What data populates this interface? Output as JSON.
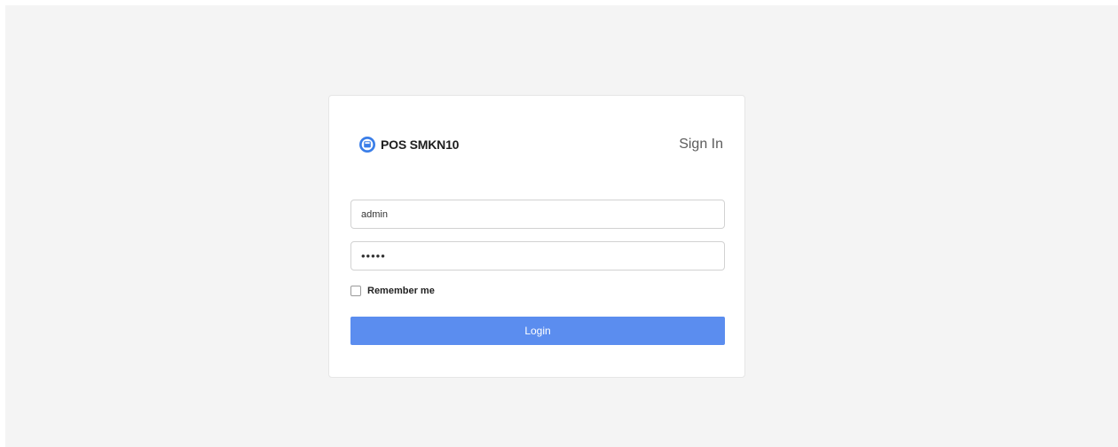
{
  "brand": {
    "name": "POS SMKN10",
    "icon": "cash-register-icon",
    "color": "#3a7ee8"
  },
  "header": {
    "title": "Sign In"
  },
  "form": {
    "username": {
      "value": "admin"
    },
    "password": {
      "value": "•••••"
    },
    "remember": {
      "label": "Remember me",
      "checked": false
    },
    "submit_label": "Login",
    "submit_color": "#5b8def"
  }
}
